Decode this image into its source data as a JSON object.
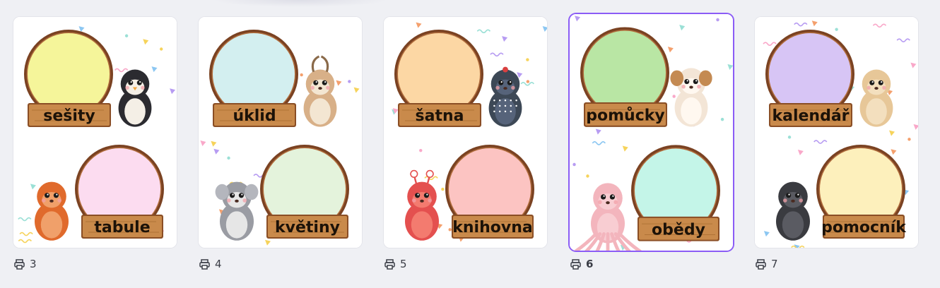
{
  "pages": [
    {
      "number": "3",
      "selected": false,
      "top_label": "sešity",
      "bottom_label": "tabule",
      "top_circle_color": "#f5f59a",
      "bottom_circle_color": "#fcdcf0",
      "top_animal": "penguin-icon",
      "bottom_animal": "orangutan-icon"
    },
    {
      "number": "4",
      "selected": false,
      "top_label": "úklid",
      "bottom_label": "květiny",
      "top_circle_color": "#d3eff0",
      "bottom_circle_color": "#e4f3dc",
      "top_animal": "goat-icon",
      "bottom_animal": "koala-icon"
    },
    {
      "number": "5",
      "selected": false,
      "top_label": "šatna",
      "bottom_label": "knihovna",
      "top_circle_color": "#fcd7a4",
      "bottom_circle_color": "#fcc4c2",
      "top_animal": "guineafowl-icon",
      "bottom_animal": "crab-icon"
    },
    {
      "number": "6",
      "selected": true,
      "top_label": "pomůcky",
      "bottom_label": "obědy",
      "top_circle_color": "#b9e6a4",
      "bottom_circle_color": "#c4f5e8",
      "top_animal": "puppy-icon",
      "bottom_animal": "octopus-icon"
    },
    {
      "number": "7",
      "selected": false,
      "top_label": "kalendář",
      "bottom_label": "pomocník",
      "top_circle_color": "#d7c5f5",
      "bottom_circle_color": "#fdf0bc",
      "top_animal": "camel-icon",
      "bottom_animal": "gorilla-icon"
    }
  ],
  "footer_icon": "printer-icon",
  "colors": {
    "selection": "#8b5cf6",
    "frame_brown": "#7a4222",
    "sign_wood": "#c98a4b",
    "background": "#eff0f4"
  }
}
